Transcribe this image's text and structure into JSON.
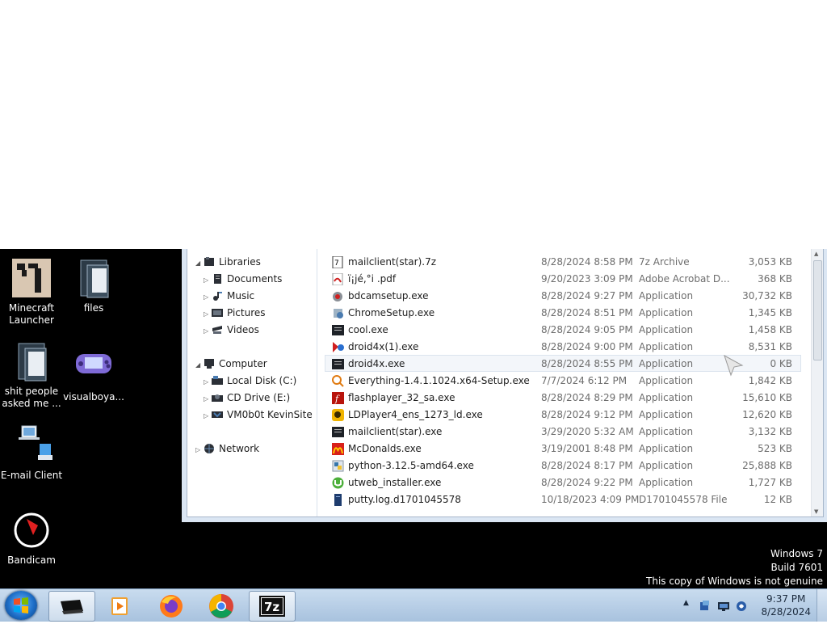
{
  "desktop_icons": [
    {
      "label": "Minecraft Launcher",
      "icon": "minecraft-icon"
    },
    {
      "label": "files",
      "icon": "folder-icon"
    },
    {
      "label": "shit people asked me ...",
      "icon": "folder-icon"
    },
    {
      "label": "visualboya...",
      "icon": "gameboy-icon"
    },
    {
      "label": "E-mail Client",
      "icon": "email-client-icon"
    },
    {
      "label": "Bandicam",
      "icon": "bandicam-icon"
    }
  ],
  "nav": {
    "libraries": "Libraries",
    "documents": "Documents",
    "music": "Music",
    "pictures": "Pictures",
    "videos": "Videos",
    "computer": "Computer",
    "local_disk": "Local Disk (C:)",
    "cd_drive": "CD Drive (E:)",
    "vm_site": "VM0b0t KevinSite",
    "network": "Network"
  },
  "files": [
    {
      "name": "mailclient(star).7z",
      "date": "8/28/2024 8:58 PM",
      "type": "7z Archive",
      "size": "3,053 KB",
      "icon": "7z-archive-icon"
    },
    {
      "name": "ï¡jé,°i .pdf",
      "date": "9/20/2023 3:09 PM",
      "type": "Adobe Acrobat D...",
      "size": "368 KB",
      "icon": "pdf-icon"
    },
    {
      "name": "bdcamsetup.exe",
      "date": "8/28/2024 9:27 PM",
      "type": "Application",
      "size": "30,732 KB",
      "icon": "bandicam-setup-icon"
    },
    {
      "name": "ChromeSetup.exe",
      "date": "8/28/2024 8:51 PM",
      "type": "Application",
      "size": "1,345 KB",
      "icon": "setup-icon"
    },
    {
      "name": "cool.exe",
      "date": "8/28/2024 9:05 PM",
      "type": "Application",
      "size": "1,458 KB",
      "icon": "exe-icon"
    },
    {
      "name": "droid4x(1).exe",
      "date": "8/28/2024 9:00 PM",
      "type": "Application",
      "size": "8,531 KB",
      "icon": "droid4x-icon"
    },
    {
      "name": "droid4x.exe",
      "date": "8/28/2024 8:55 PM",
      "type": "Application",
      "size": "0 KB",
      "icon": "exe-icon"
    },
    {
      "name": "Everything-1.4.1.1024.x64-Setup.exe",
      "date": "7/7/2024 6:12 PM",
      "type": "Application",
      "size": "1,842 KB",
      "icon": "everything-icon"
    },
    {
      "name": "flashplayer_32_sa.exe",
      "date": "8/28/2024 8:29 PM",
      "type": "Application",
      "size": "15,610 KB",
      "icon": "flash-icon"
    },
    {
      "name": "LDPlayer4_ens_1273_ld.exe",
      "date": "8/28/2024 9:12 PM",
      "type": "Application",
      "size": "12,620 KB",
      "icon": "ldplayer-icon"
    },
    {
      "name": "mailclient(star).exe",
      "date": "3/29/2020 5:32 AM",
      "type": "Application",
      "size": "3,132 KB",
      "icon": "exe-icon"
    },
    {
      "name": "McDonalds.exe",
      "date": "3/19/2001 8:48 PM",
      "type": "Application",
      "size": "523 KB",
      "icon": "mcdonalds-icon"
    },
    {
      "name": "python-3.12.5-amd64.exe",
      "date": "8/28/2024 8:17 PM",
      "type": "Application",
      "size": "25,888 KB",
      "icon": "python-installer-icon"
    },
    {
      "name": "utweb_installer.exe",
      "date": "8/28/2024 9:22 PM",
      "type": "Application",
      "size": "1,727 KB",
      "icon": "utorrent-icon"
    },
    {
      "name": "putty.log.d1701045578",
      "date": "10/18/2023 4:09 PM",
      "type": "D1701045578 File",
      "size": "12 KB",
      "icon": "file-icon"
    }
  ],
  "watermark": {
    "line1": "Windows 7",
    "line2": "Build 7601",
    "line3": "This copy of Windows is not genuine"
  },
  "taskbar": {
    "apps": [
      "explorer-icon",
      "media-player-icon",
      "firefox-icon",
      "chrome-icon",
      "7zip-icon"
    ],
    "time": "9:37 PM",
    "date": "8/28/2024"
  },
  "colors": {
    "taskbar": "#a8c2de",
    "desktop": "#000000",
    "selection": "#f3f6fa",
    "link_text": "#1e1e1e",
    "meta_text": "#6d6d6d"
  }
}
